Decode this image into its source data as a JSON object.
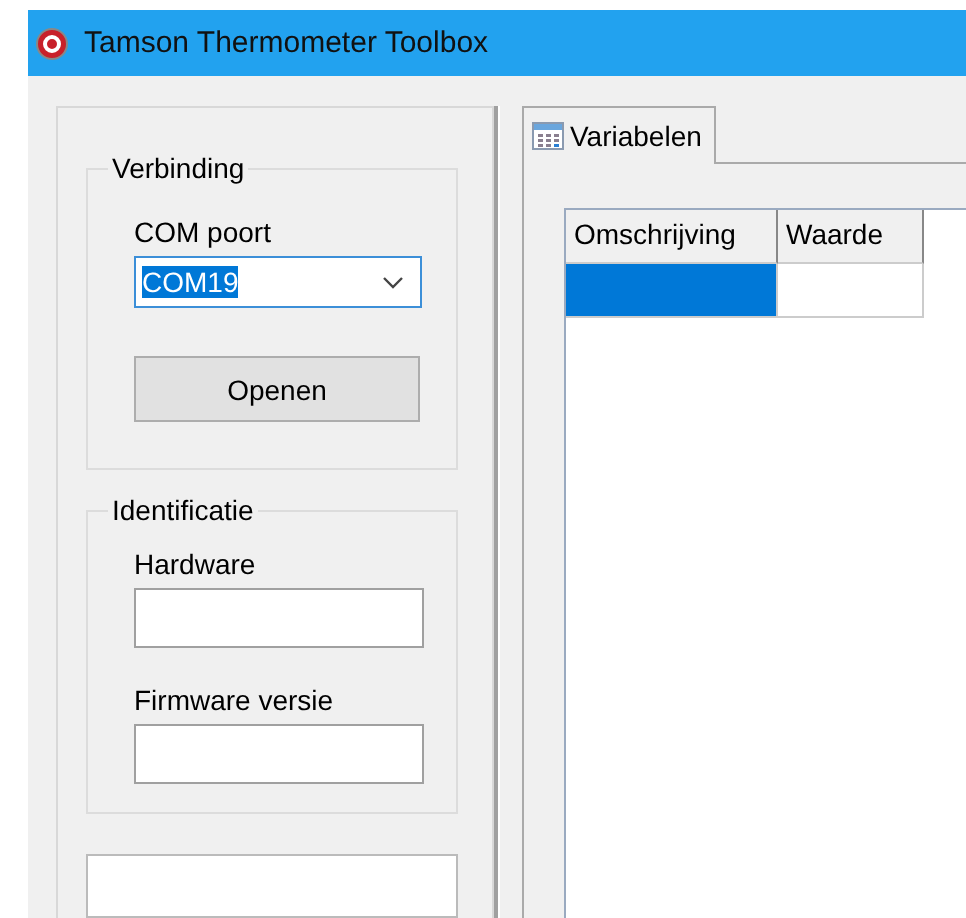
{
  "window": {
    "title": "Tamson Thermometer Toolbox"
  },
  "connection": {
    "title": "Verbinding",
    "port_label": "COM poort",
    "port_value": "COM19",
    "open_button": "Openen"
  },
  "identification": {
    "title": "Identificatie",
    "fields": [
      {
        "label": "Hardware"
      },
      {
        "label": "Firmware versie"
      }
    ]
  },
  "tabs": [
    {
      "label": "Variabelen",
      "selected": true
    }
  ],
  "table": {
    "columns": [
      "Omschrijving",
      "Waarde"
    ],
    "rows": [
      {
        "selected": true
      }
    ]
  }
}
